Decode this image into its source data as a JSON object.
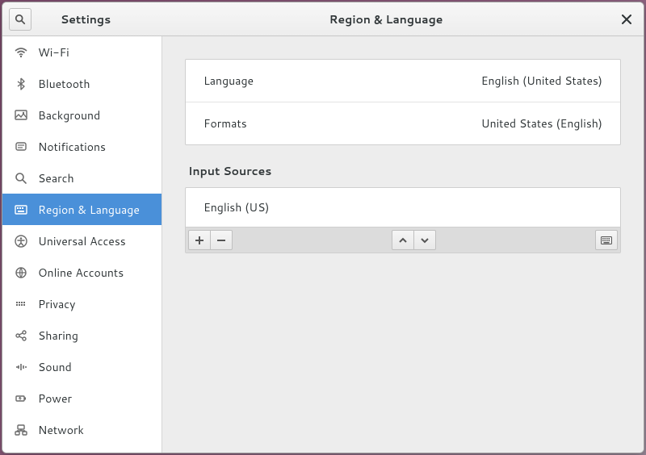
{
  "titlebar": {
    "sidebar_title": "Settings",
    "page_title": "Region & Language"
  },
  "sidebar": {
    "items": [
      {
        "icon": "wifi",
        "label": "Wi-Fi"
      },
      {
        "icon": "bluetooth",
        "label": "Bluetooth"
      },
      {
        "icon": "background",
        "label": "Background"
      },
      {
        "icon": "notifications",
        "label": "Notifications"
      },
      {
        "icon": "search",
        "label": "Search"
      },
      {
        "icon": "region",
        "label": "Region & Language"
      },
      {
        "icon": "universal",
        "label": "Universal Access"
      },
      {
        "icon": "online",
        "label": "Online Accounts"
      },
      {
        "icon": "privacy",
        "label": "Privacy"
      },
      {
        "icon": "sharing",
        "label": "Sharing"
      },
      {
        "icon": "sound",
        "label": "Sound"
      },
      {
        "icon": "power",
        "label": "Power"
      },
      {
        "icon": "network",
        "label": "Network"
      }
    ],
    "selected_index": 5
  },
  "region": {
    "language_label": "Language",
    "language_value": "English (United States)",
    "formats_label": "Formats",
    "formats_value": "United States (English)",
    "input_sources_title": "Input Sources",
    "sources": [
      {
        "name": "English (US)"
      }
    ]
  }
}
